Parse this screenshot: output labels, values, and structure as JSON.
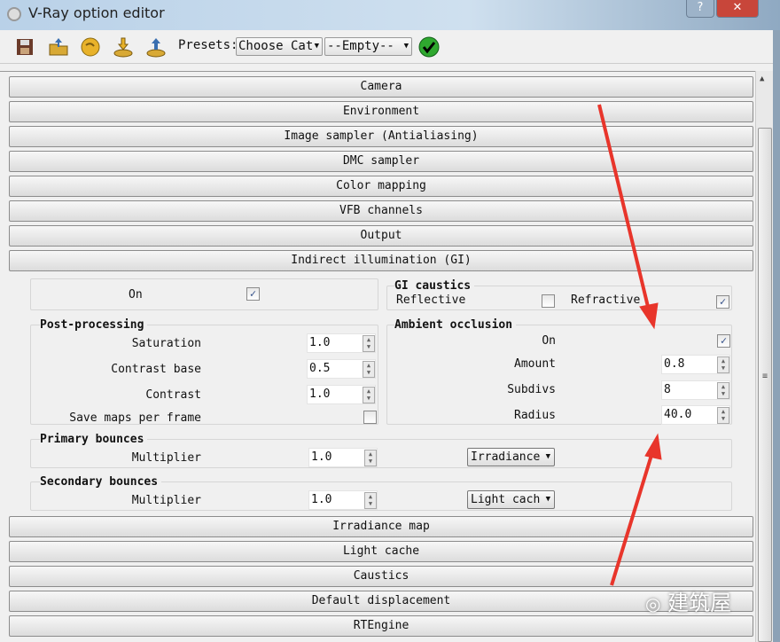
{
  "window": {
    "title": "V-Ray option editor",
    "help": "?",
    "close": "✕"
  },
  "toolbar": {
    "icons": [
      "save-icon",
      "open-icon",
      "reset-icon",
      "import-icon",
      "export-icon"
    ],
    "presets_label": "Presets:",
    "category": "Choose Cat",
    "preset": "--Empty--",
    "apply": "✔"
  },
  "sections_top": [
    "Camera",
    "Environment",
    "Image sampler (Antialiasing)",
    "DMC sampler",
    "Color mapping",
    "VFB channels",
    "Output",
    "Indirect illumination (GI)"
  ],
  "gi": {
    "on_label": "On",
    "on": true,
    "caustics": {
      "title": "GI caustics",
      "reflective_label": "Reflective",
      "reflective": false,
      "refractive_label": "Refractive",
      "refractive": true
    },
    "post": {
      "title": "Post-processing",
      "saturation_label": "Saturation",
      "saturation": "1.0",
      "contrast_base_label": "Contrast base",
      "contrast_base": "0.5",
      "contrast_label": "Contrast",
      "contrast": "1.0",
      "save_maps_label": "Save maps per frame",
      "save_maps": false
    },
    "ao": {
      "title": "Ambient occlusion",
      "on_label": "On",
      "on": true,
      "amount_label": "Amount",
      "amount": "0.8",
      "subdivs_label": "Subdivs",
      "subdivs": "8",
      "radius_label": "Radius",
      "radius": "40.0"
    },
    "primary": {
      "title": "Primary bounces",
      "multiplier_label": "Multiplier",
      "multiplier": "1.0",
      "engine": "Irradiance"
    },
    "secondary": {
      "title": "Secondary bounces",
      "multiplier_label": "Multiplier",
      "multiplier": "1.0",
      "engine": "Light cach"
    }
  },
  "sections_bottom": [
    "Irradiance map",
    "Light cache",
    "Caustics",
    "Default displacement",
    "RTEngine"
  ],
  "watermark": "建筑屋",
  "colors": {
    "arrow": "#e8352b"
  }
}
